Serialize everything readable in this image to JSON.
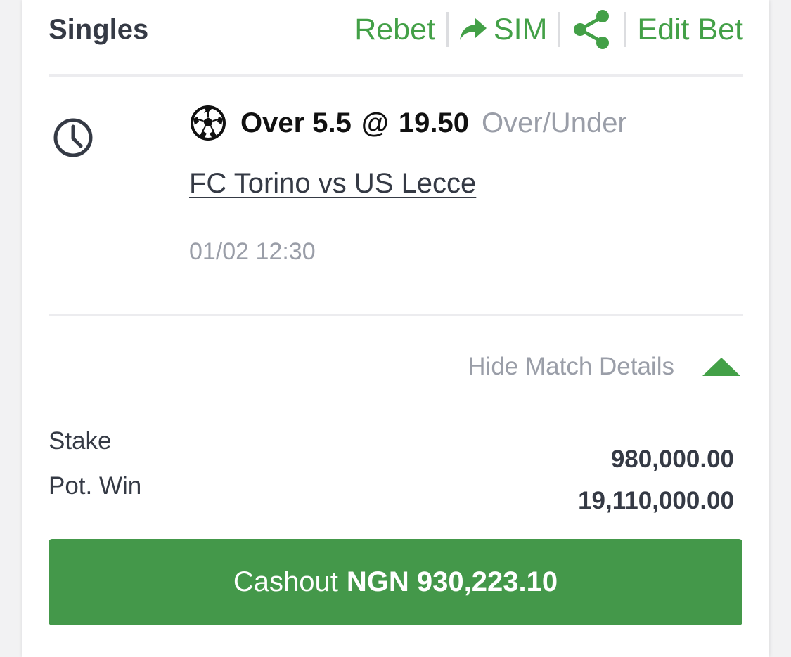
{
  "header": {
    "title": "Singles",
    "rebet": "Rebet",
    "sim": "SIM",
    "edit_bet": "Edit Bet"
  },
  "bet": {
    "status_icon": "clock-icon",
    "sport_icon": "soccer-ball-icon",
    "selection": "Over 5.5",
    "at": "@",
    "odds": "19.50",
    "market": "Over/Under",
    "match": "FC Torino vs US Lecce",
    "datetime": "01/02 12:30"
  },
  "details": {
    "toggle_label": "Hide Match Details",
    "stake_label": "Stake",
    "stake_value": "980,000.00",
    "pot_win_label": "Pot. Win",
    "pot_win_value": "19,110,000.00"
  },
  "cashout": {
    "label": "Cashout",
    "amount": "NGN 930,223.10"
  },
  "colors": {
    "accent": "#43a047",
    "button": "#44984a",
    "text": "#353a45",
    "muted": "#9a9ea8"
  }
}
